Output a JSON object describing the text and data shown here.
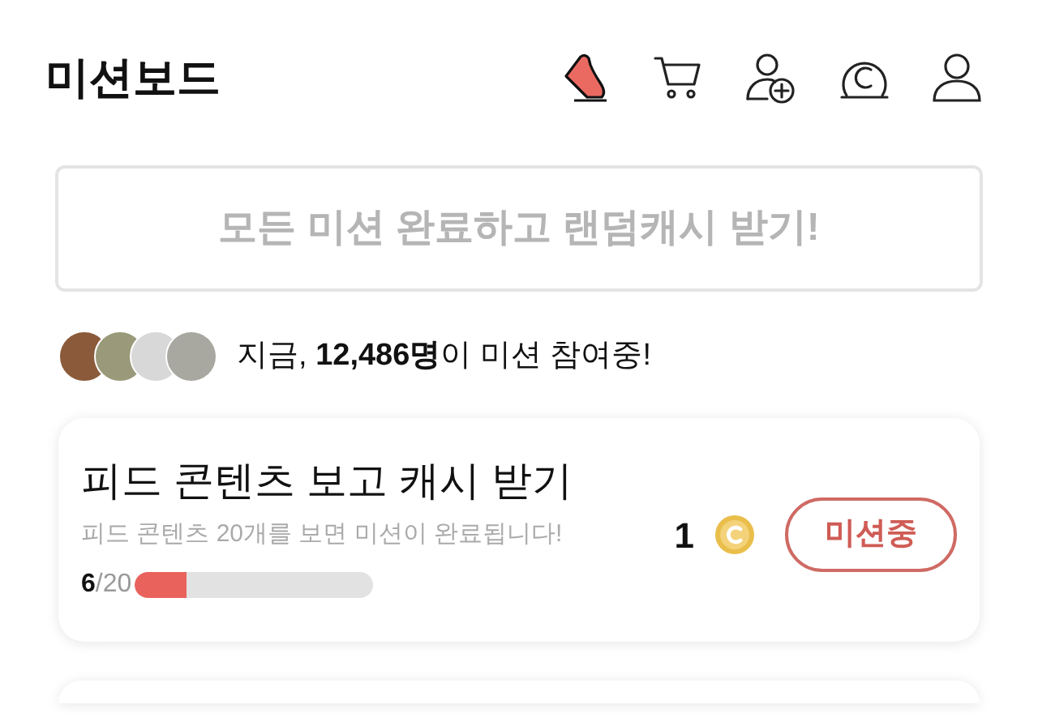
{
  "header": {
    "title": "미션보드"
  },
  "banner": {
    "label": "모든 미션 완료하고 랜덤캐시 받기!"
  },
  "participants": {
    "text": "지금, **12,486명**이 미션 참여중!"
  },
  "missions": [
    {
      "title": "피드 콘텐츠 보고 캐시 받기",
      "description": "피드 콘텐츠 20개를 보면 미션이 완료됩니다!",
      "progress": "**6**/20",
      "level": 0.22,
      "reward": "1",
      "status": "미션중"
    }
  ]
}
